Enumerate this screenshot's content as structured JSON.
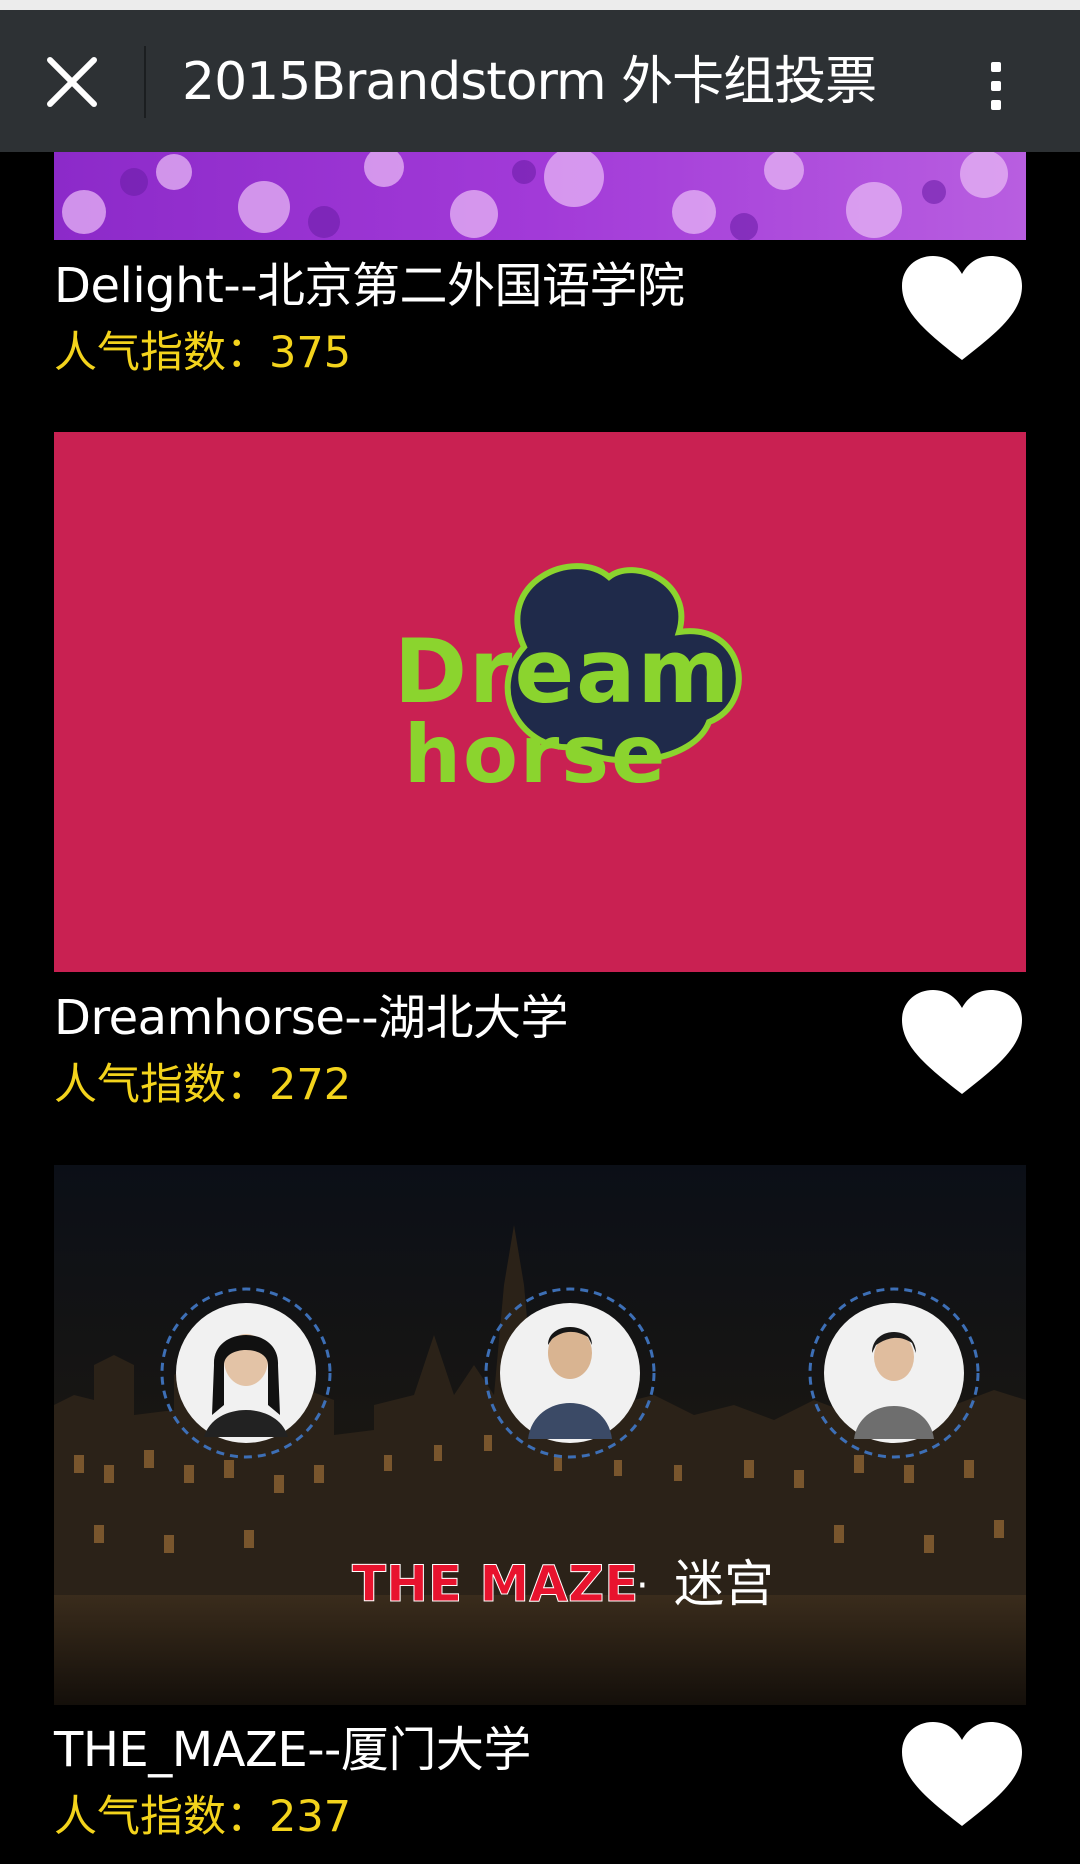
{
  "navbar": {
    "title": "2015Brandstorm 外卡组投票",
    "close_icon": "close-icon",
    "more_icon": "more-vertical-icon"
  },
  "entries": [
    {
      "name": "Delight--北京第二外国语学院",
      "popularity_label": "人气指数：",
      "popularity_value": "375",
      "vote_icon": "heart-icon"
    },
    {
      "name": "Dreamhorse--湖北大学",
      "popularity_label": "人气指数：",
      "popularity_value": "272",
      "vote_icon": "heart-icon",
      "logo_line1": "Dream",
      "logo_line2": "horse"
    },
    {
      "name": "THE_MAZE--厦门大学",
      "popularity_label": "人气指数：",
      "popularity_value": "237",
      "vote_icon": "heart-icon",
      "banner_en": "THE MAZE",
      "banner_sep": "·",
      "banner_cn": "迷宫"
    }
  ],
  "colors": {
    "navbar_bg": "#2d3134",
    "popularity_text": "#f3d31c",
    "dreamhorse_bg": "#c92152",
    "dreamhorse_logo_green": "#8bd42e",
    "dreamhorse_logo_navy": "#1f2a4a",
    "maze_red": "#e8132e"
  }
}
